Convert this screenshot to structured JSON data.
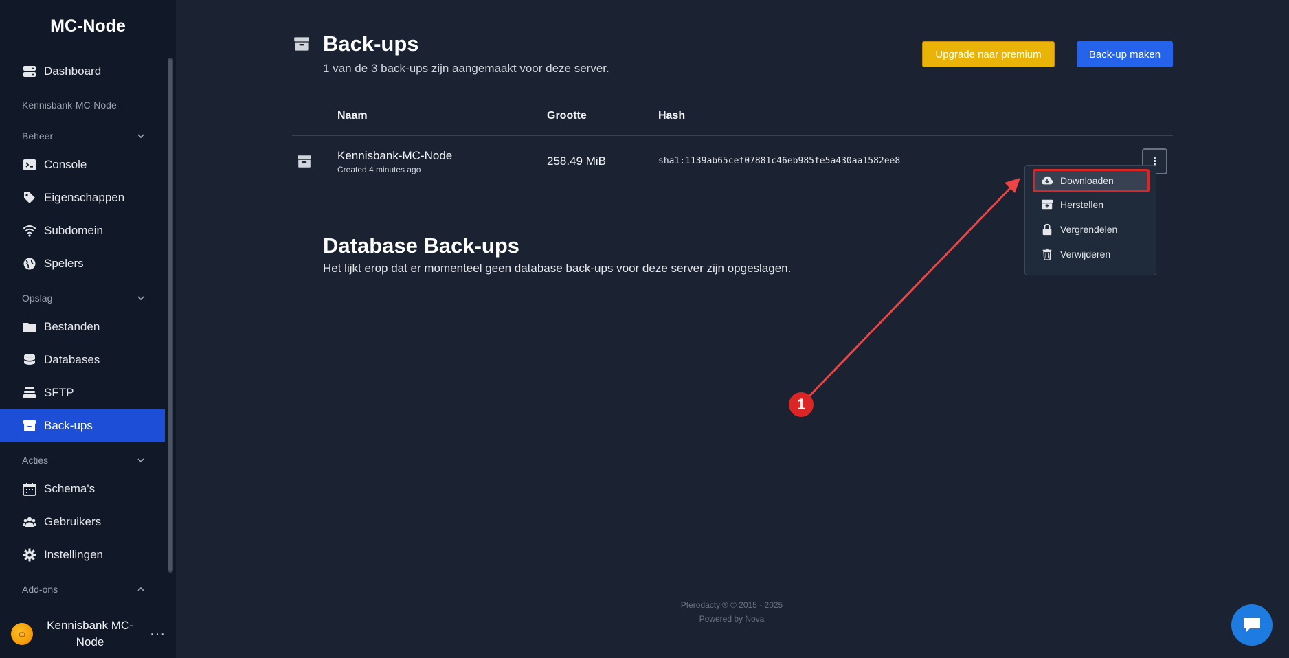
{
  "sidebar": {
    "brand": "MC-Node",
    "server_name": "Kennisbank-MC-Node",
    "items": {
      "dashboard": "Dashboard",
      "console": "Console",
      "eigenschappen": "Eigenschappen",
      "subdomein": "Subdomein",
      "spelers": "Spelers",
      "bestanden": "Bestanden",
      "databases": "Databases",
      "sftp": "SFTP",
      "backups": "Back-ups",
      "schemas": "Schema's",
      "gebruikers": "Gebruikers",
      "instellingen": "Instellingen"
    },
    "sections": {
      "beheer": "Beheer",
      "opslag": "Opslag",
      "acties": "Acties",
      "addons": "Add-ons"
    },
    "user": {
      "name": "Kennisbank MC-Node",
      "more": "···"
    }
  },
  "main": {
    "title": "Back-ups",
    "subtitle": "1 van de 3 back-ups zijn aangemaakt voor deze server.",
    "premium_label": "Upgrade naar premium",
    "create_label": "Back-up maken",
    "columns": {
      "name": "Naam",
      "size": "Grootte",
      "hash": "Hash"
    },
    "row": {
      "name": "Kennisbank-MC-Node",
      "created": "Created 4 minutes ago",
      "size": "258.49 MiB",
      "hash": "sha1:1139ab65cef07881c46eb985fe5a430aa1582ee8"
    },
    "menu": {
      "download": "Downloaden",
      "restore": "Herstellen",
      "lock": "Vergrendelen",
      "delete": "Verwijderen"
    },
    "db_title": "Database Back-ups",
    "db_subtitle": "Het lijkt erop dat er momenteel geen database back-ups voor deze server zijn opgeslagen."
  },
  "annotation": {
    "badge": "1"
  },
  "footer": {
    "line1": "Pterodactyl® © 2015 - 2025",
    "line2": "Powered by Nova"
  },
  "colors": {
    "accent": "#1d4ed8",
    "premium": "#eab308",
    "highlight": "#dc2626",
    "background": "#1b2333"
  }
}
